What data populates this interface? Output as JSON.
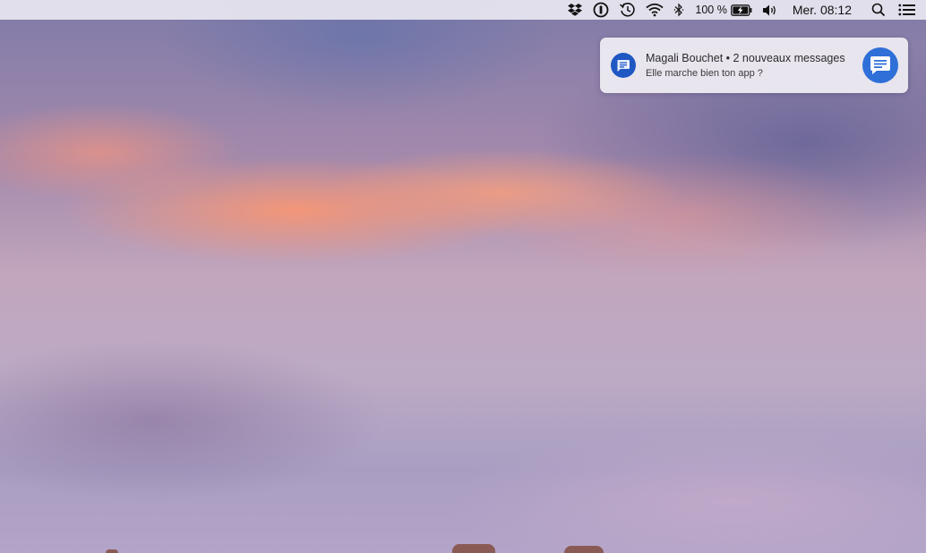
{
  "menubar": {
    "icons": [
      "dropbox-icon",
      "onepassword-icon",
      "time-machine-icon",
      "wifi-icon",
      "bluetooth-icon",
      "battery-icon",
      "volume-icon",
      "spotlight-search-icon",
      "notification-center-icon"
    ],
    "battery_percent": "100 %",
    "clock": "Mer. 08:12"
  },
  "notification": {
    "title": "Magali Bouchet • 2 nouveaux messages",
    "body": "Elle marche bien ton app ?",
    "app_icon": "messages-icon",
    "avatar_icon": "messages-icon",
    "accent_color": "#2f6fd8"
  }
}
